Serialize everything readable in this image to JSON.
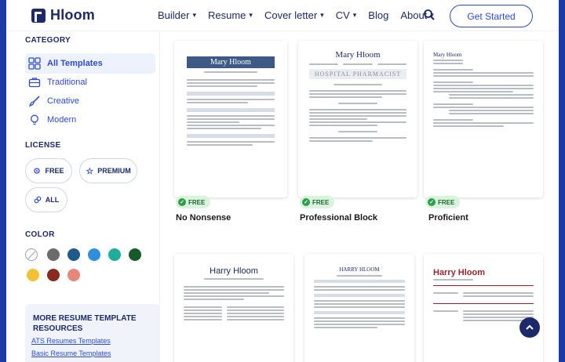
{
  "brand": {
    "name": "Hloom"
  },
  "nav": [
    {
      "label": "Builder",
      "has_caret": true
    },
    {
      "label": "Resume",
      "has_caret": true
    },
    {
      "label": "Cover letter",
      "has_caret": true
    },
    {
      "label": "CV",
      "has_caret": true
    },
    {
      "label": "Blog",
      "has_caret": false
    },
    {
      "label": "About",
      "has_caret": true
    }
  ],
  "header": {
    "cta_label": "Get Started",
    "search_icon": "search-icon"
  },
  "sidebar": {
    "category_title": "CATEGORY",
    "categories": [
      {
        "label": "All Templates",
        "icon": "grid-icon",
        "active": true
      },
      {
        "label": "Traditional",
        "icon": "briefcase-icon",
        "active": false
      },
      {
        "label": "Creative",
        "icon": "brush-icon",
        "active": false
      },
      {
        "label": "Modern",
        "icon": "lightbulb-icon",
        "active": false
      }
    ],
    "license_title": "LICENSE",
    "license": [
      {
        "label": "FREE",
        "icon": "gear-icon"
      },
      {
        "label": "PREMIUM",
        "icon": "star-icon"
      },
      {
        "label": "ALL",
        "icon": "link-icon"
      }
    ],
    "color_title": "COLOR",
    "colors": [
      "none",
      "#6b6b6b",
      "#1f5a8c",
      "#2f8fdc",
      "#1eae9b",
      "#165a2a",
      "#f2c234",
      "#8b2a1e",
      "#e8867a"
    ],
    "more_title": "MORE RESUME TEMPLATE RESOURCES",
    "more_links": [
      "ATS Resumes Templates",
      "Basic Resume Templates"
    ]
  },
  "cards": [
    {
      "name": "No Nonsense",
      "badge": "FREE",
      "resume_name": "Mary Hloom"
    },
    {
      "name": "Professional Block",
      "badge": "FREE",
      "resume_name": "Mary Hloom",
      "resume_subtitle": "HOSPITAL PHARMACIST"
    },
    {
      "name": "Proficient",
      "badge": "FREE",
      "resume_name": "Mary Hloom"
    },
    {
      "name": "",
      "badge": "",
      "resume_name": "Harry Hloom"
    },
    {
      "name": "",
      "badge": "",
      "resume_name": "HARRY HLOOM"
    },
    {
      "name": "",
      "badge": "",
      "resume_name": "Harry Hloom"
    }
  ]
}
